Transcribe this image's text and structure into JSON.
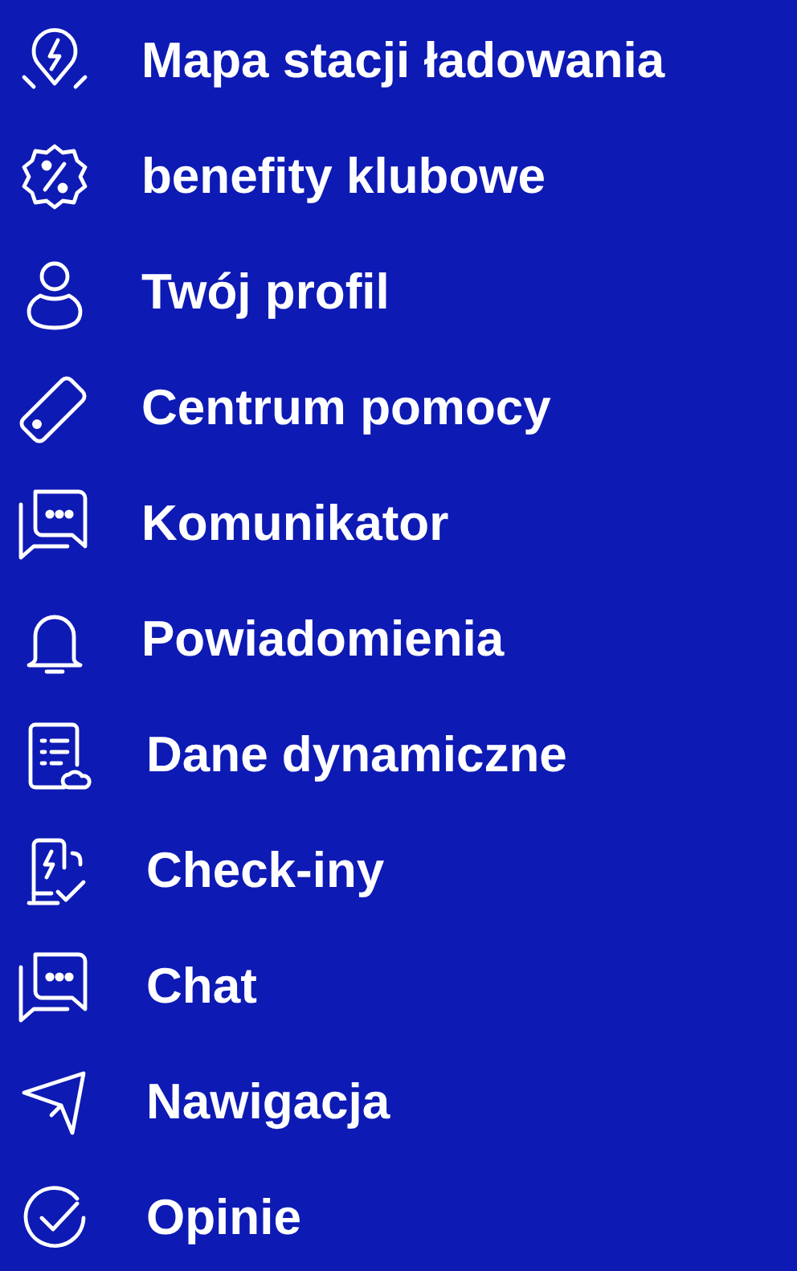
{
  "menu": {
    "items": [
      {
        "label": "Mapa stacji ładowania"
      },
      {
        "label": "benefity klubowe"
      },
      {
        "label": "Twój profil"
      },
      {
        "label": "Centrum pomocy"
      },
      {
        "label": "Komunikator"
      },
      {
        "label": "Powiadomienia"
      },
      {
        "label": "Dane dynamiczne"
      },
      {
        "label": "Check-iny"
      },
      {
        "label": "Chat"
      },
      {
        "label": "Nawigacja"
      },
      {
        "label": "Opinie"
      }
    ]
  }
}
